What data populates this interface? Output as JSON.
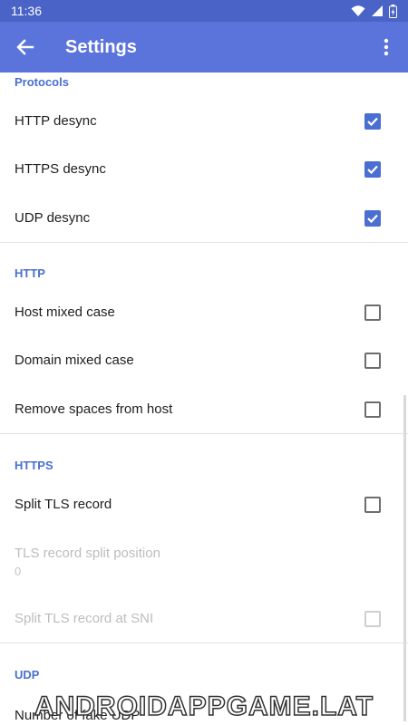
{
  "status_bar": {
    "time": "11:36"
  },
  "app_bar": {
    "title": "Settings"
  },
  "sections": {
    "protocols": {
      "header": "Protocols",
      "items": [
        {
          "label": "HTTP desync",
          "checked": true
        },
        {
          "label": "HTTPS desync",
          "checked": true
        },
        {
          "label": "UDP desync",
          "checked": true
        }
      ]
    },
    "http": {
      "header": "HTTP",
      "items": [
        {
          "label": "Host mixed case",
          "checked": false
        },
        {
          "label": "Domain mixed case",
          "checked": false
        },
        {
          "label": "Remove spaces from host",
          "checked": false
        }
      ]
    },
    "https": {
      "header": "HTTPS",
      "items": [
        {
          "label": "Split TLS record",
          "checked": false
        },
        {
          "label": "TLS record split position",
          "summary": "0",
          "enabled": false
        },
        {
          "label": "Split TLS record at SNI",
          "checked": false,
          "enabled": false
        }
      ]
    },
    "udp": {
      "header": "UDP",
      "items": [
        {
          "label": "Number of fake UDP"
        }
      ]
    }
  },
  "watermark": "ANDROIDAPPGAME.LAT",
  "colors": {
    "status_bar": "#4a63c6",
    "app_bar": "#5b74dc",
    "accent": "#4a6fd0"
  }
}
